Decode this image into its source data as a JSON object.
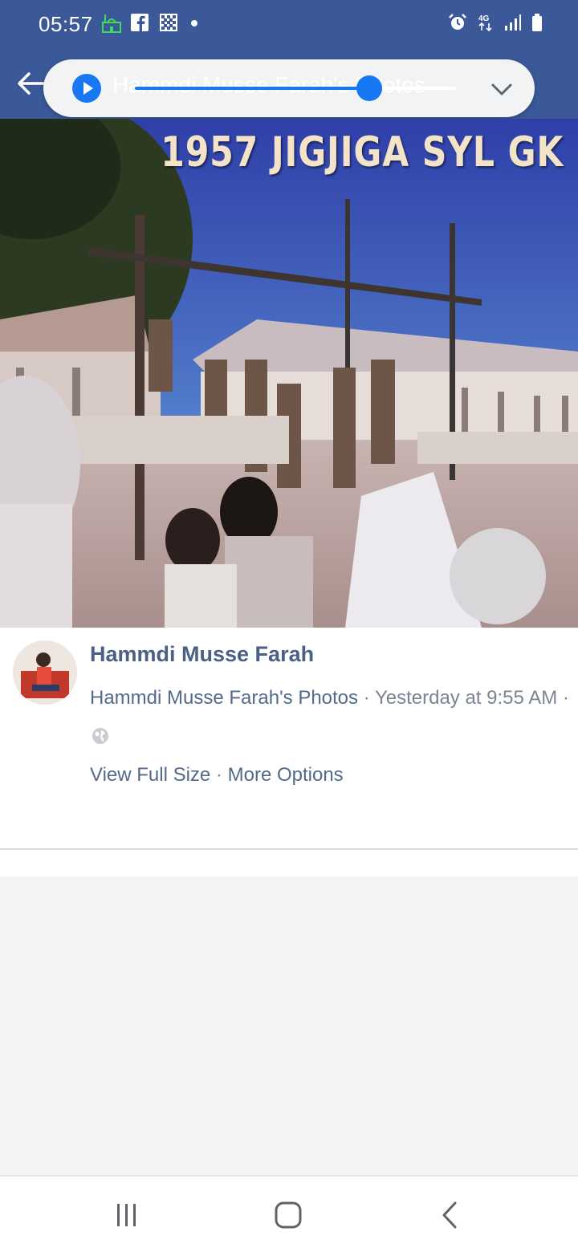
{
  "status_bar": {
    "time": "05:57",
    "left_icons": [
      "mosque-icon",
      "facebook-icon",
      "qr-icon"
    ],
    "right_icons": [
      "alarm-icon",
      "4g-icon",
      "signal-icon",
      "battery-icon"
    ],
    "network_label": "4G"
  },
  "media_overlay": {
    "title": "Hammdi Musse Farah's Photos",
    "progress": 0.73,
    "accent_color": "#1877f2"
  },
  "photo": {
    "caption": "1957 JIGJIGA SYL GK"
  },
  "post": {
    "author": "Hammdi Musse Farah",
    "album": "Hammdi Musse Farah's Photos",
    "separator": "·",
    "timestamp": "Yesterday at 9:55 AM",
    "privacy_icon": "globe-icon",
    "actions": {
      "view_full_size": "View Full Size",
      "more_options": "More Options"
    }
  },
  "nav_bar": {
    "buttons": [
      "recents-icon",
      "home-icon",
      "back-icon"
    ]
  },
  "colors": {
    "header": "#3b5998",
    "link_text": "#546a8a",
    "author_text": "#4b6184"
  }
}
